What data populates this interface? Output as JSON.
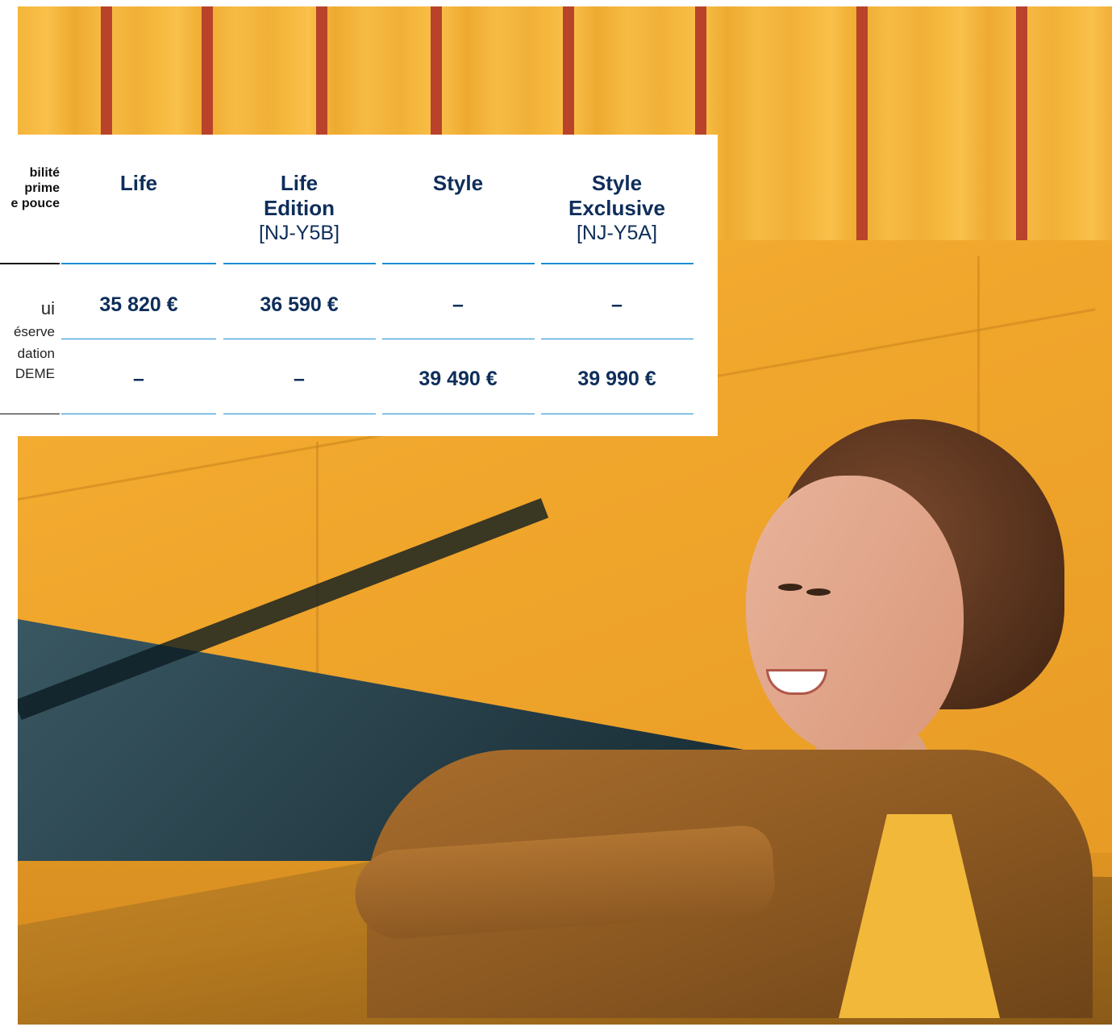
{
  "table": {
    "header": {
      "row_label_lines": [
        "bilité",
        "prime",
        "e pouce"
      ],
      "columns": [
        {
          "name_lines": [
            "Life"
          ],
          "code": ""
        },
        {
          "name_lines": [
            "Life",
            "Edition"
          ],
          "code": "[NJ-Y5B]"
        },
        {
          "name_lines": [
            "Style"
          ],
          "code": ""
        },
        {
          "name_lines": [
            "Style",
            "Exclusive"
          ],
          "code": "[NJ-Y5A]"
        }
      ]
    },
    "left_text": {
      "row1_main": "ui",
      "row1_sub": "éserve",
      "row2_line1": "dation",
      "row2_line2": "DEME"
    },
    "rows": [
      {
        "values": [
          "35 820 €",
          "36 590 €",
          "–",
          "–"
        ]
      },
      {
        "values": [
          "–",
          "–",
          "39 490 €",
          "39 990 €"
        ]
      }
    ]
  },
  "colors": {
    "navy": "#0e2e5a",
    "accent_blue": "#1a8ed6",
    "wall_orange": "#f2a72a",
    "stripe_red": "#b8432a"
  }
}
